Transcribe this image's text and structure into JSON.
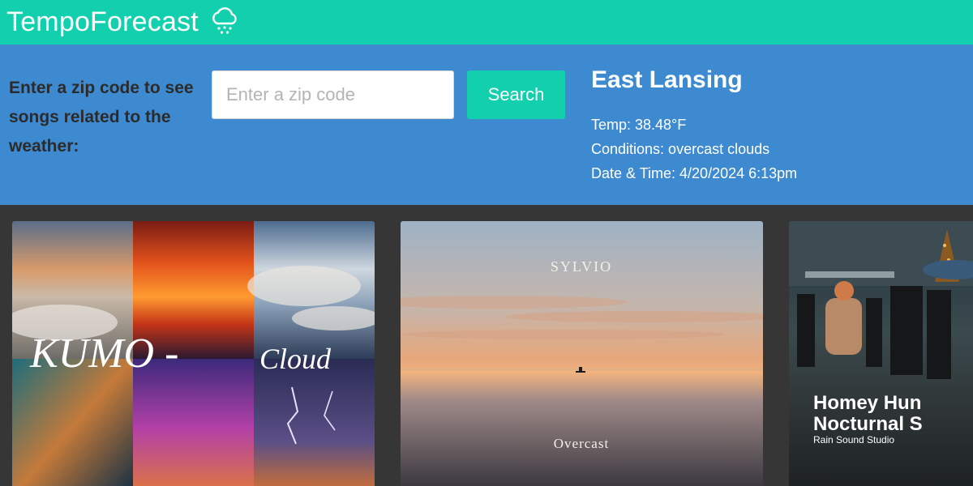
{
  "header": {
    "app_name": "TempoForecast",
    "icon": "rain-cloud-icon"
  },
  "search": {
    "prompt": "Enter a zip code to see songs related to the weather:",
    "placeholder": "Enter a zip code",
    "value": "",
    "button_label": "Search"
  },
  "weather": {
    "city": "East Lansing",
    "temp": "Temp: 38.48°F",
    "conditions": "Conditions: overcast clouds",
    "datetime": "Date & Time: 4/20/2024 6:13pm"
  },
  "songs": [
    {
      "cover_title": "KUMO - Cloud"
    },
    {
      "cover_artist": "SYLVIO",
      "cover_title": "Overcast"
    },
    {
      "cover_title_line1": "Homey Hun",
      "cover_title_line2": "Nocturnal S",
      "cover_artist": "Rain Sound Studio"
    }
  ],
  "colors": {
    "topbar": "#12d0ad",
    "panel": "#3e8ad1",
    "page_bg": "#363636",
    "button": "#12d0ad"
  }
}
